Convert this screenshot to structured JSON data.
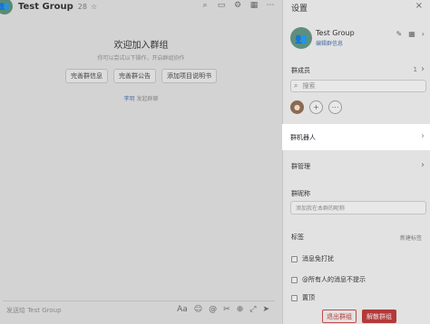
{
  "chat": {
    "title": "Test Group",
    "member_count": "28",
    "star": "☆",
    "avatar_glyph": "👥",
    "tools": [
      "search-icon",
      "video-icon",
      "settings-icon",
      "calendar-icon",
      "more-icon"
    ],
    "tool_glyphs": [
      "⌕",
      "▭",
      "⚙",
      "▦",
      "⋯"
    ],
    "welcome_title": "欢迎加入群组",
    "welcome_sub": "你可以尝试以下操作，开启群组协作",
    "welcome_buttons": [
      "完善群信息",
      "完善群公告",
      "添加项目说明书"
    ],
    "note_name": "李玥",
    "note_text": "发起群聊",
    "input_placeholder": "发送给 Test Group",
    "input_tools": [
      "Aa",
      "☺",
      "@",
      "✂",
      "⊕",
      "⤢",
      "➤"
    ]
  },
  "panel": {
    "title": "设置",
    "close": "×",
    "group_name": "Test Group",
    "edit_link": "编辑群信息",
    "avatar_glyph": "👥",
    "header_icons": [
      "✎",
      "▦",
      "›"
    ],
    "members_label": "群成员",
    "members_count": "1",
    "search_placeholder": "搜索",
    "member_add": "+",
    "member_more": "⋯",
    "bot_label": "群机器人",
    "manage_label": "群管理",
    "nickname_label": "群昵称",
    "nickname_placeholder": "添加我在本群的昵称",
    "tag_label": "标签",
    "tag_add": "新建标签",
    "checks": [
      "消息免打扰",
      "@所有人的消息不提示",
      "置顶"
    ],
    "exit_button": "退出群组",
    "dismiss_button": "解散群组"
  },
  "colors": {
    "dim_chat": "#d3d3d3",
    "dim_panel": "#e2e2e2",
    "highlight": "#ffffff",
    "danger": "#b33a3a",
    "link": "#4a6fa5"
  }
}
